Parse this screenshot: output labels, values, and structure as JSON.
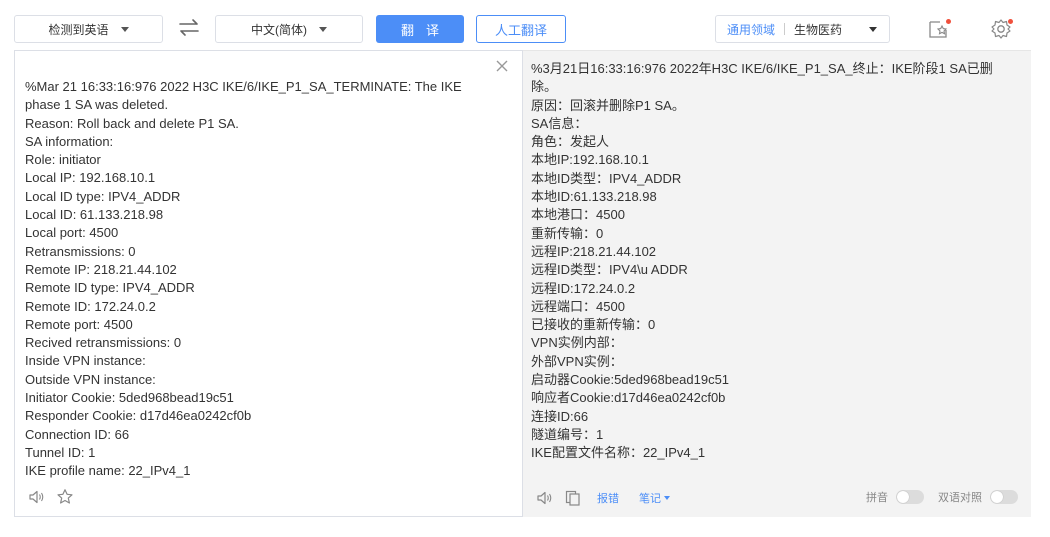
{
  "toolbar": {
    "source_lang": "检测到英语",
    "target_lang": "中文(简体)",
    "translate_label": "翻译",
    "human_translate_label": "人工翻译",
    "domain_label": "通用领域",
    "domain_value": "生物医药"
  },
  "colors": {
    "accent": "#4c8ef7",
    "notification_dot": "#f0503c",
    "right_panel_bg": "#f3f3f3"
  },
  "source": {
    "lines": [
      "%Mar 21 16:33:16:976 2022 H3C IKE/6/IKE_P1_SA_TERMINATE: The IKE",
      "phase 1 SA was deleted.",
      "Reason: Roll back and delete P1 SA.",
      "SA information:",
      "Role: initiator",
      "Local IP: 192.168.10.1",
      "Local ID type: IPV4_ADDR",
      "Local ID: 61.133.218.98",
      "Local port: 4500",
      "Retransmissions: 0",
      "Remote IP: 218.21.44.102",
      "Remote ID type: IPV4_ADDR",
      "Remote ID: 172.24.0.2",
      "Remote port: 4500",
      "Recived retransmissions: 0",
      "Inside VPN instance:",
      "Outside VPN instance:",
      "Initiator Cookie: 5ded968bead19c51",
      "Responder Cookie: d17d46ea0242cf0b",
      "Connection ID: 66",
      "Tunnel ID: 1",
      "IKE profile name: 22_IPv4_1"
    ]
  },
  "target": {
    "lines": [
      "%3月21日16:33:16:976 2022年H3C IKE/6/IKE_P1_SA_终止：IKE阶段1 SA已删",
      "除。",
      "原因：回滚并删除P1 SA。",
      "SA信息：",
      "角色：发起人",
      "本地IP:192.168.10.1",
      "本地ID类型：IPV4_ADDR",
      "本地ID:61.133.218.98",
      "本地港口：4500",
      "重新传输：0",
      "远程IP:218.21.44.102",
      "远程ID类型：IPV4\\u ADDR",
      "远程ID:172.24.0.2",
      "远程端口：4500",
      "已接收的重新传输：0",
      "VPN实例内部：",
      "外部VPN实例：",
      "启动器Cookie:5ded968bead19c51",
      "响应者Cookie:d17d46ea0242cf0b",
      "连接ID:66",
      "隧道编号：1",
      "IKE配置文件名称：22_IPv4_1"
    ],
    "pinyin_label": "拼音",
    "bilingual_label": "双语对照",
    "report_label": "报错",
    "notes_label": "笔记"
  },
  "icons": {
    "swap": "swap-icon",
    "favorites": "star-box-icon",
    "settings": "gear-icon",
    "close": "close-icon",
    "speaker": "speaker-icon",
    "star": "star-icon",
    "copy": "copy-icon"
  }
}
